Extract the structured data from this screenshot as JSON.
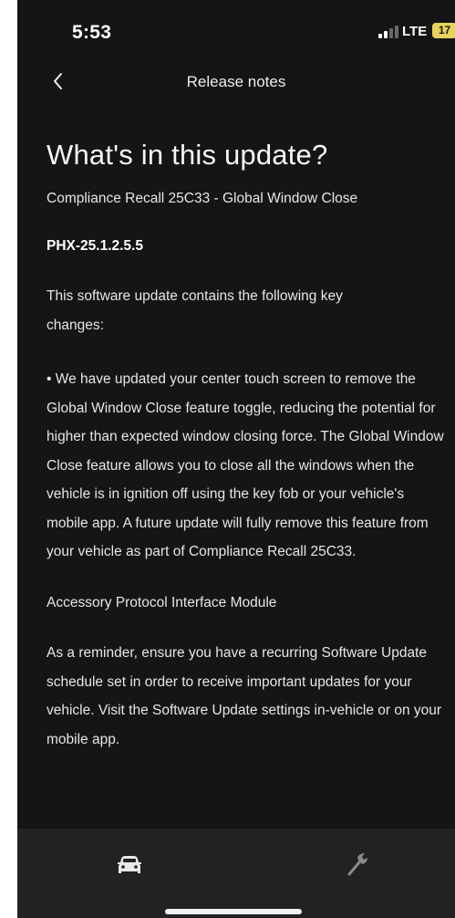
{
  "status_bar": {
    "time": "5:53",
    "network": "LTE",
    "battery": "17",
    "battery_color": "#e7d25a"
  },
  "nav": {
    "back_icon": "chevron-left-icon",
    "title": "Release notes"
  },
  "content": {
    "heading": "What's in this update?",
    "subtitle": "Compliance Recall 25C33 - Global Window Close",
    "version": "PHX-25.1.2.5.5",
    "intro": "This software update contains the following key changes:",
    "bullet": "• We have updated your center touch screen to remove the Global Window Close feature toggle, reducing the potential for higher than expected window closing force. The Global Window Close feature allows you to close all the windows when the vehicle is in ignition off using the key fob or your vehicle's mobile app. A future update will fully remove this feature from your vehicle as part of Compliance Recall 25C33.",
    "module": "Accessory Protocol Interface Module",
    "reminder": "As a reminder, ensure you have a recurring Software Update schedule set in order to receive important updates for your vehicle. Visit the Software Update settings in-vehicle or on your mobile app."
  },
  "bottom_bar": {
    "tabs": [
      {
        "icon": "vehicle-icon",
        "active": true
      },
      {
        "icon": "wrench-icon",
        "active": false
      }
    ]
  }
}
